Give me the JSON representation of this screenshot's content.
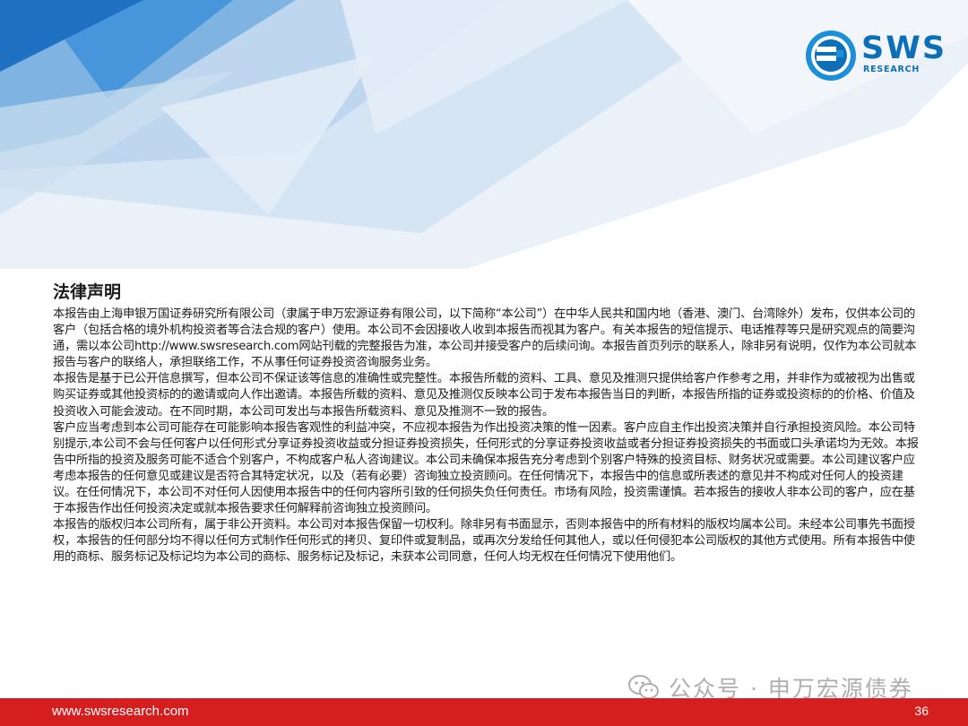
{
  "logo": {
    "name": "SWS",
    "tagline": "RESEARCH"
  },
  "document": {
    "title": "法律声明",
    "paragraphs": [
      "本报告由上海申银万国证券研究所有限公司（隶属于申万宏源证券有限公司，以下简称“本公司”）在中华人民共和国内地（香港、澳门、台湾除外）发布，仅供本公司的客户（包括合格的境外机构投资者等合法合规的客户）使用。本公司不会因接收人收到本报告而视其为客户。有关本报告的短信提示、电话推荐等只是研究观点的简要沟通，需以本公司http://www.swsresearch.com网站刊载的完整报告为准，本公司并接受客户的后续问询。本报告首页列示的联系人，除非另有说明，仅作为本公司就本报告与客户的联络人，承担联络工作，不从事任何证券投资咨询服务业务。",
      "本报告是基于已公开信息撰写，但本公司不保证该等信息的准确性或完整性。本报告所载的资料、工具、意见及推测只提供给客户作参考之用，并非作为或被视为出售或购买证券或其他投资标的的邀请或向人作出邀请。本报告所载的资料、意见及推测仅反映本公司于发布本报告当日的判断，本报告所指的证券或投资标的的价格、价值及投资收入可能会波动。在不同时期，本公司可发出与本报告所载资料、意见及推测不一致的报告。",
      "客户应当考虑到本公司可能存在可能影响本报告客观性的利益冲突，不应视本报告为作出投资决策的惟一因素。客户应自主作出投资决策并自行承担投资风险。本公司特别提示,本公司不会与任何客户以任何形式分享证券投资收益或分担证券投资损失，任何形式的分享证券投资收益或者分担证券投资损失的书面或口头承诺均为无效。本报告中所指的投资及服务可能不适合个别客户，不构成客户私人咨询建议。本公司未确保本报告充分考虑到个别客户特殊的投资目标、财务状况或需要。本公司建议客户应考虑本报告的任何意见或建议是否符合其特定状况，以及（若有必要）咨询独立投资顾问。在任何情况下，本报告中的信息或所表述的意见并不构成对任何人的投资建议。在任何情况下，本公司不对任何人因使用本报告中的任何内容所引致的任何损失负任何责任。市场有风险，投资需谨慎。若本报告的接收人非本公司的客户，应在基于本报告作出任何投资决定或就本报告要求任何解释前咨询独立投资顾问。",
      "本报告的版权归本公司所有，属于非公开资料。本公司对本报告保留一切权利。除非另有书面显示，否则本报告中的所有材料的版权均属本公司。未经本公司事先书面授权，本报告的任何部分均不得以任何方式制作任何形式的拷贝、复印件或复制品，或再次分发给任何其他人，或以任何侵犯本公司版权的其他方式使用。所有本报告中使用的商标、服务标记及标记均为本公司的商标、服务标记及标记，未获本公司同意，任何人均无权在任何情况下使用他们。"
    ]
  },
  "watermark": {
    "text": "公众号 · 申万宏源债券"
  },
  "footer": {
    "url": "www.swsresearch.com",
    "page_number": "36"
  },
  "colors": {
    "brand_blue": "#0d6fb8",
    "footer_red": "#d51f1f"
  }
}
